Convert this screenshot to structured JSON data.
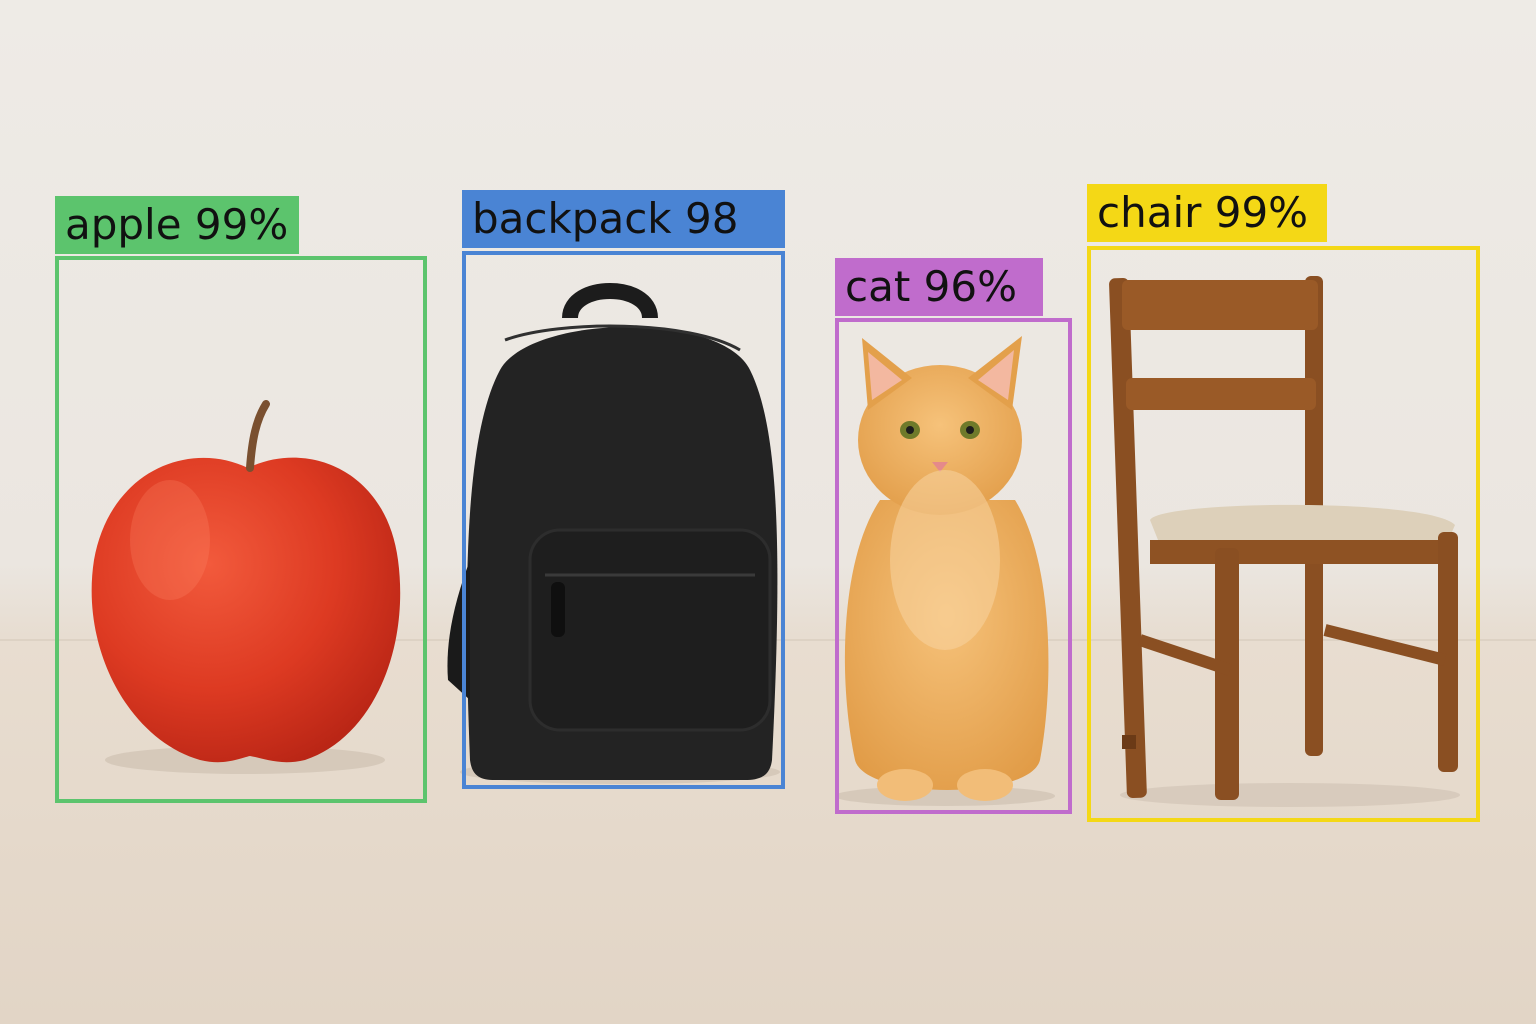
{
  "image": {
    "description_kind": "object-detection-result",
    "background_colors": {
      "wall": "#ece8e2",
      "floor": "#e5d9cb"
    }
  },
  "detections": [
    {
      "label": "apple 99%",
      "color": "#5cc46d",
      "object": "apple-icon"
    },
    {
      "label": "backpack 98",
      "color": "#4a84d4",
      "object": "backpack-icon"
    },
    {
      "label": "cat 96%",
      "color": "#c06ccc",
      "object": "cat-icon"
    },
    {
      "label": "chair 99%",
      "color": "#f4d816",
      "object": "chair-icon"
    }
  ]
}
